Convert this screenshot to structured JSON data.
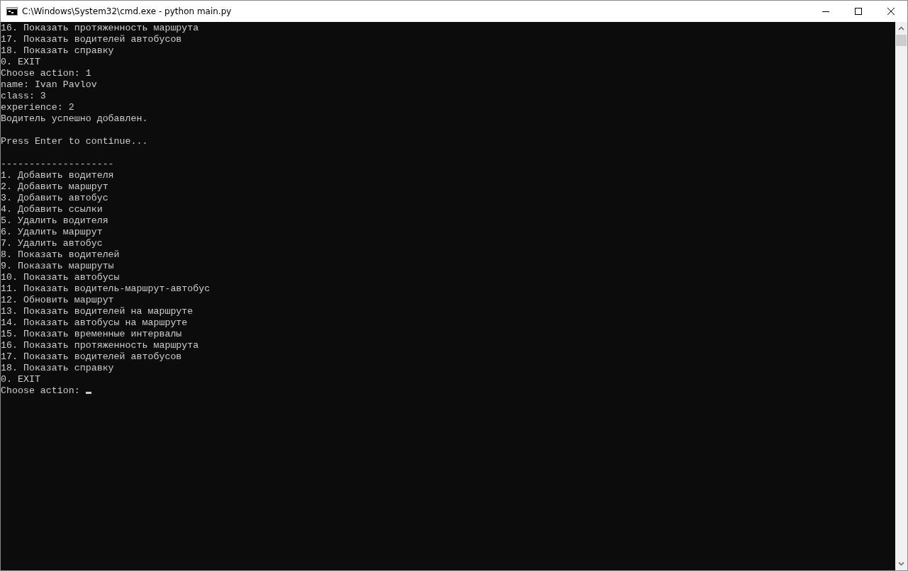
{
  "window": {
    "title": "C:\\Windows\\System32\\cmd.exe - python  main.py"
  },
  "console": {
    "lines": [
      {
        "kind": "text",
        "text": "16. Показать протяженность маршрута"
      },
      {
        "kind": "text",
        "text": "17. Показать водителей автобусов"
      },
      {
        "kind": "text",
        "text": "18. Показать справку"
      },
      {
        "kind": "text",
        "text": "0. EXIT"
      },
      {
        "kind": "text",
        "text": "Choose action: 1"
      },
      {
        "kind": "text",
        "text": "name: Ivan Pavlov"
      },
      {
        "kind": "text",
        "text": "class: 3"
      },
      {
        "kind": "text",
        "text": "experience: 2"
      },
      {
        "kind": "text",
        "text": "Водитель успешно добавлен."
      },
      {
        "kind": "blank"
      },
      {
        "kind": "text",
        "text": "Press Enter to continue..."
      },
      {
        "kind": "blank"
      },
      {
        "kind": "text",
        "text": "--------------------"
      },
      {
        "kind": "text",
        "text": "1. Добавить водителя"
      },
      {
        "kind": "text",
        "text": "2. Добавить маршрут"
      },
      {
        "kind": "text",
        "text": "3. Добавить автобус"
      },
      {
        "kind": "text",
        "text": "4. Добавить ссылки"
      },
      {
        "kind": "text",
        "text": "5. Удалить водителя"
      },
      {
        "kind": "text",
        "text": "6. Удалить маршрут"
      },
      {
        "kind": "text",
        "text": "7. Удалить автобус"
      },
      {
        "kind": "text",
        "text": "8. Показать водителей"
      },
      {
        "kind": "text",
        "text": "9. Показать маршруты"
      },
      {
        "kind": "text",
        "text": "10. Показать автобусы"
      },
      {
        "kind": "text",
        "text": "11. Показать водитель-маршрут-автобус"
      },
      {
        "kind": "text",
        "text": "12. Обновить маршрут"
      },
      {
        "kind": "text",
        "text": "13. Показать водителей на маршруте"
      },
      {
        "kind": "text",
        "text": "14. Показать автобусы на маршруте"
      },
      {
        "kind": "text",
        "text": "15. Показать временные интервалы"
      },
      {
        "kind": "text",
        "text": "16. Показать протяженность маршрута"
      },
      {
        "kind": "text",
        "text": "17. Показать водителей автобусов"
      },
      {
        "kind": "text",
        "text": "18. Показать справку"
      },
      {
        "kind": "text",
        "text": "0. EXIT"
      },
      {
        "kind": "prompt",
        "text": "Choose action: "
      }
    ]
  }
}
